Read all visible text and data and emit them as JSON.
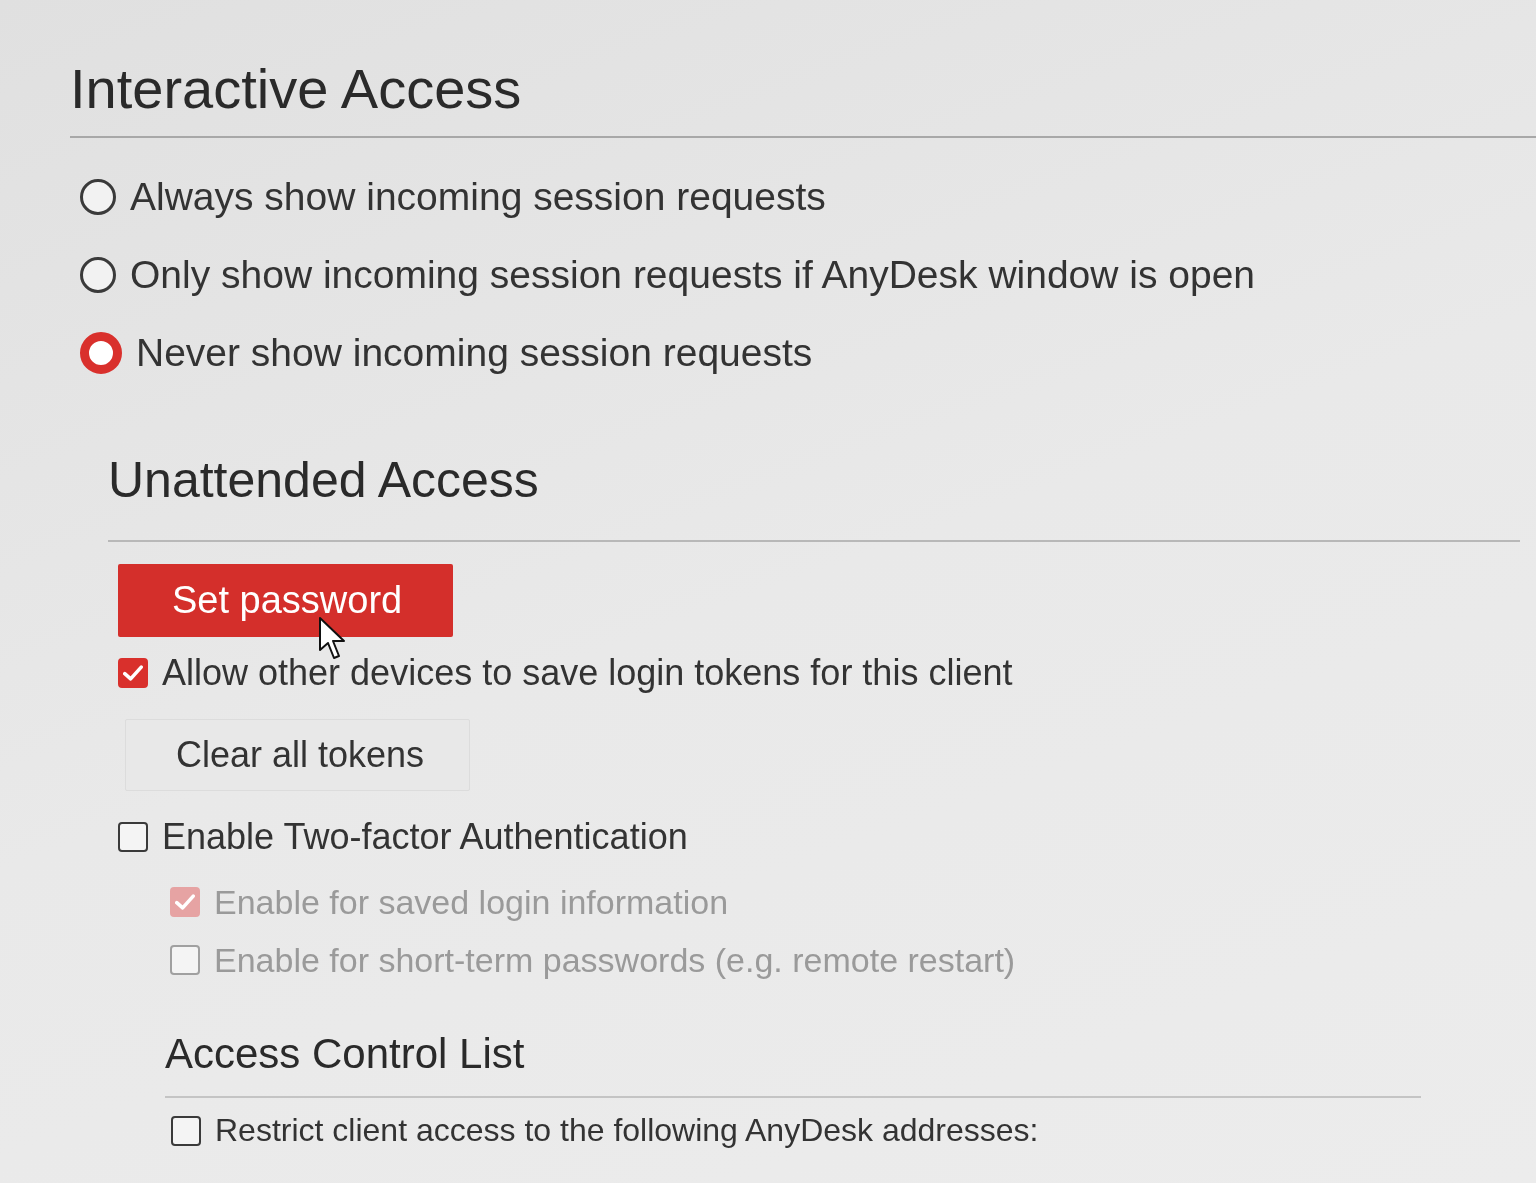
{
  "sections": [
    {
      "title": "Interactive Access",
      "items": [
        {
          "kind": "radio",
          "label": "Always show incoming session requests",
          "selected": false
        },
        {
          "kind": "radio",
          "label": "Only show incoming session requests if AnyDesk window is open",
          "selected": false
        },
        {
          "kind": "radio",
          "label": "Never show incoming session requests",
          "selected": true
        }
      ]
    },
    {
      "title": "Unattended Access",
      "items": [
        {
          "kind": "primary-button",
          "label": "Set password"
        },
        {
          "kind": "checkbox",
          "label": "Allow other devices to save login tokens for this client",
          "checked": true,
          "disabled": false
        },
        {
          "kind": "button",
          "label": "Clear all tokens"
        },
        {
          "kind": "checkbox",
          "label": "Enable Two-factor Authentication",
          "checked": false,
          "disabled": false,
          "children": [
            {
              "kind": "checkbox",
              "label": "Enable for saved login information",
              "checked": true,
              "disabled": true
            },
            {
              "kind": "checkbox",
              "label": "Enable for short-term passwords (e.g. remote restart)",
              "checked": false,
              "disabled": true
            }
          ]
        }
      ]
    },
    {
      "title": "Access Control List",
      "items": [
        {
          "kind": "checkbox",
          "label": "Restrict client access to the following AnyDesk addresses:",
          "checked": false,
          "disabled": false
        }
      ]
    }
  ]
}
